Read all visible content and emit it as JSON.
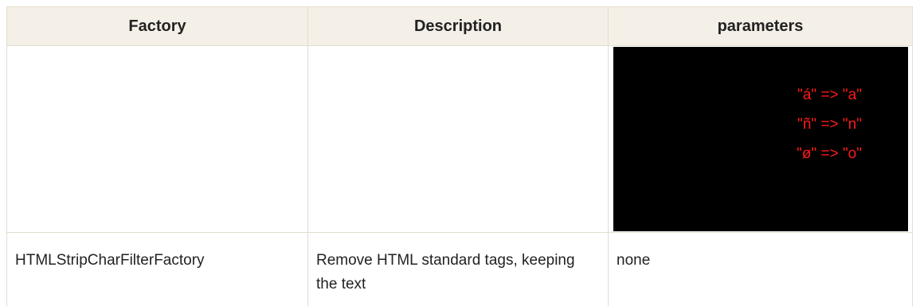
{
  "table": {
    "headers": [
      "Factory",
      "Description",
      "parameters"
    ],
    "rows": [
      {
        "factory": "",
        "description": "",
        "parameters": {
          "mappings": [
            "\"á\" => \"a\"",
            "\"ñ\" => \"n\"",
            "\"ø\" => \"o\""
          ]
        }
      },
      {
        "factory": "HTMLStripCharFilterFactory",
        "description": "Remove HTML standard tags, keeping the text",
        "parameters": {
          "text": "none"
        }
      }
    ]
  },
  "colors": {
    "header_background": "#f4efe7",
    "border": "#e3ddd0",
    "code_background": "#000000",
    "code_text": "#ff1a1a"
  }
}
